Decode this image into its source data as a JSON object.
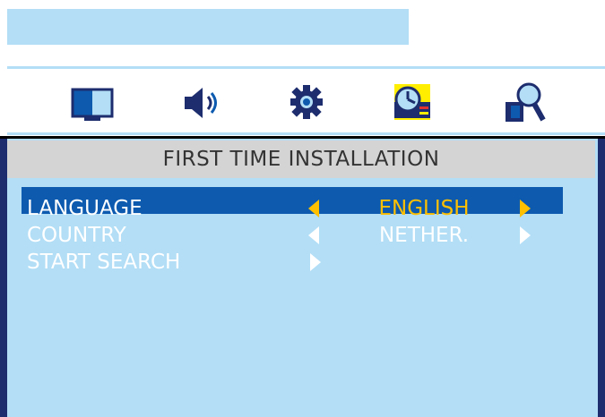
{
  "colors": {
    "osd_light_blue": "#b3def6",
    "highlight_blue": "#0d5aaf",
    "highlight_text": "#ffc000",
    "title_gray": "#d4d4d4"
  },
  "icons": [
    {
      "name": "picture-icon",
      "selected": false
    },
    {
      "name": "sound-icon",
      "selected": false
    },
    {
      "name": "features-icon",
      "selected": false
    },
    {
      "name": "install-icon",
      "selected": true
    },
    {
      "name": "search-icon",
      "selected": false
    }
  ],
  "panel": {
    "title": "FIRST TIME INSTALLATION",
    "rows": [
      {
        "label": "LANGUAGE",
        "value": "ENGLISH",
        "selected": true
      },
      {
        "label": "COUNTRY",
        "value": "NETHER.",
        "selected": false
      },
      {
        "label": "START SEARCH",
        "value": "",
        "selected": false
      }
    ]
  }
}
